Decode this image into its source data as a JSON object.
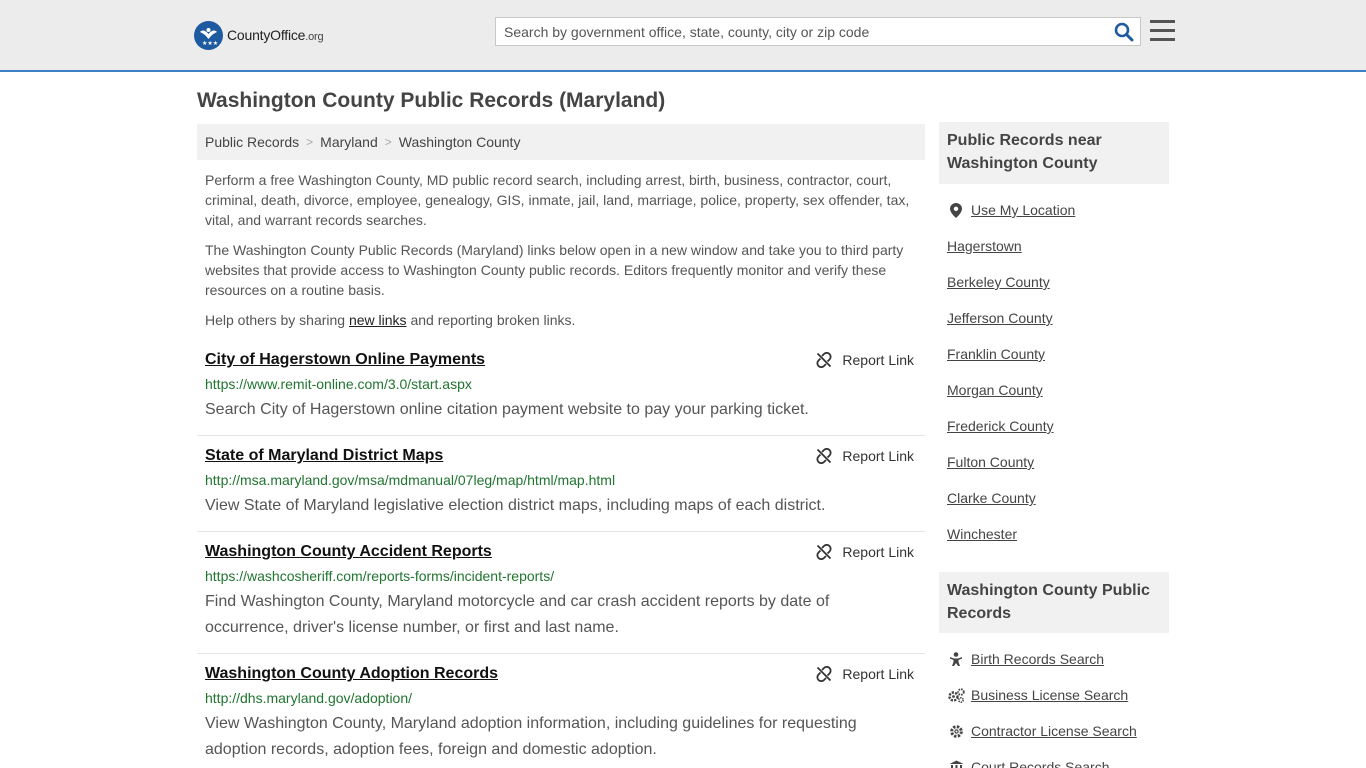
{
  "header": {
    "logo_main": "CountyOffice",
    "logo_suffix": ".org",
    "search_placeholder": "Search by government office, state, county, city or zip code"
  },
  "page": {
    "title": "Washington County Public Records (Maryland)",
    "breadcrumb": [
      "Public Records",
      "Maryland",
      "Washington County"
    ],
    "intro1": "Perform a free Washington County, MD public record search, including arrest, birth, business, contractor, court, criminal, death, divorce, employee, genealogy, GIS, inmate, jail, land, marriage, police, property, sex offender, tax, vital, and warrant records searches.",
    "intro2": "The Washington County Public Records (Maryland) links below open in a new window and take you to third party websites that provide access to Washington County public records. Editors frequently monitor and verify these resources on a routine basis.",
    "help_prefix": "Help others by sharing ",
    "help_link": "new links",
    "help_suffix": " and reporting broken links."
  },
  "records": [
    {
      "title": "City of Hagerstown Online Payments",
      "url": "https://www.remit-online.com/3.0/start.aspx",
      "desc": "Search City of Hagerstown online citation payment website to pay your parking ticket.",
      "report": "Report Link"
    },
    {
      "title": "State of Maryland District Maps",
      "url": "http://msa.maryland.gov/msa/mdmanual/07leg/map/html/map.html",
      "desc": "View State of Maryland legislative election district maps, including maps of each district.",
      "report": "Report Link"
    },
    {
      "title": "Washington County Accident Reports",
      "url": "https://washcosheriff.com/reports-forms/incident-reports/",
      "desc": "Find Washington County, Maryland motorcycle and car crash accident reports by date of occurrence, driver's license number, or first and last name.",
      "report": "Report Link"
    },
    {
      "title": "Washington County Adoption Records",
      "url": "http://dhs.maryland.gov/adoption/",
      "desc": "View Washington County, Maryland adoption information, including guidelines for requesting adoption records, adoption fees, foreign and domestic adoption.",
      "report": "Report Link"
    }
  ],
  "sidebar": {
    "near_title": "Public Records near Washington County",
    "use_location": "Use My Location",
    "near_items": [
      "Hagerstown",
      "Berkeley County",
      "Jefferson County",
      "Franklin County",
      "Morgan County",
      "Frederick County",
      "Fulton County",
      "Clarke County",
      "Winchester"
    ],
    "county_title": "Washington County Public Records",
    "county_items": [
      {
        "label": "Birth Records Search",
        "icon": "baby-icon"
      },
      {
        "label": "Business License Search",
        "icon": "gears-icon"
      },
      {
        "label": "Contractor License Search",
        "icon": "gear-icon"
      },
      {
        "label": "Court Records Search",
        "icon": "courthouse-icon"
      }
    ]
  }
}
